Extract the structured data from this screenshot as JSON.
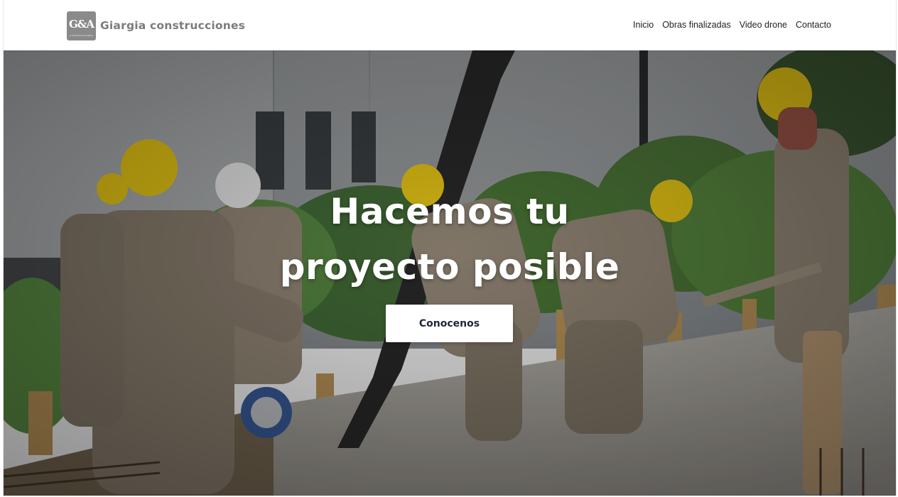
{
  "header": {
    "logo": {
      "letters": "G&A",
      "subtitle": "CONSTRUCCIONES"
    },
    "brand_name": "Giargia construcciones",
    "nav": [
      {
        "label": "Inicio"
      },
      {
        "label": "Obras finalizadas"
      },
      {
        "label": "Video drone"
      },
      {
        "label": "Contacto"
      }
    ]
  },
  "hero": {
    "title_line1": "Hacemos tu",
    "title_line2": "proyecto posible",
    "cta_label": "Conocenos",
    "background": "construction-workers-pouring-concrete-photo"
  },
  "colors": {
    "header_bg": "#ffffff",
    "brand_text": "#7c7c7c",
    "logo_bg": "#8a8a8a",
    "nav_text": "#222222",
    "hero_title": "#ffffff",
    "cta_bg": "#ffffff",
    "cta_text": "#22263a",
    "helmet": "#f2cf17"
  }
}
